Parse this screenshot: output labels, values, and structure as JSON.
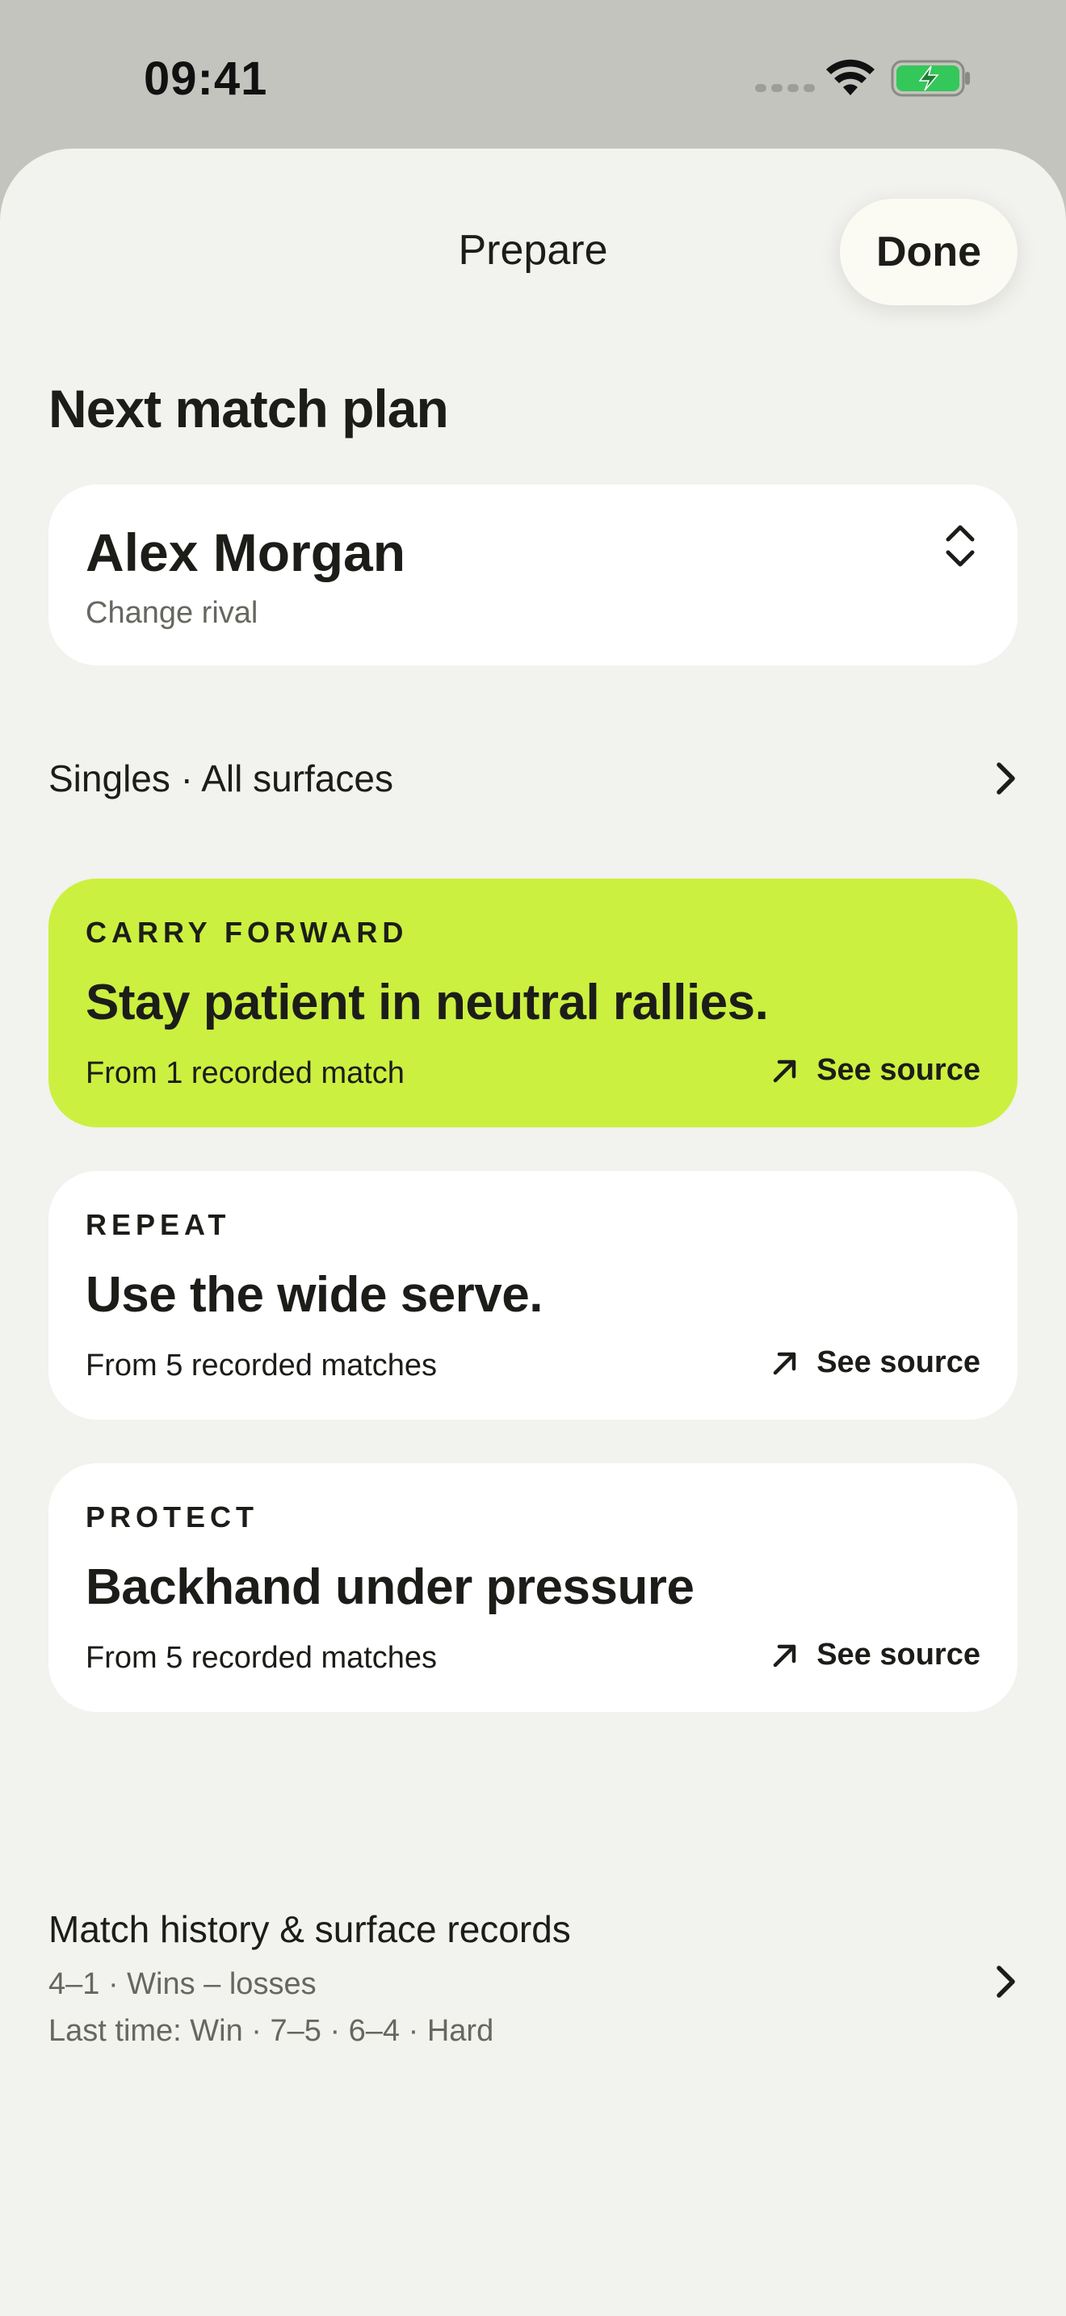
{
  "status_bar": {
    "time": "09:41",
    "icons": [
      "signal-dots-icon",
      "wifi-icon",
      "battery-charging-icon"
    ],
    "battery_color": "#34c759"
  },
  "sheet": {
    "title": "Prepare",
    "done_label": "Done"
  },
  "plan": {
    "heading": "Next match plan",
    "rival": {
      "name": "Alex Morgan",
      "subtitle": "Change rival",
      "icon": "chevron-up-down-icon"
    },
    "filter": {
      "label": "Singles · All surfaces",
      "icon": "chevron-right-icon"
    },
    "cards": [
      {
        "kicker": "CARRY FORWARD",
        "title": "Stay patient in neutral rallies.",
        "meta": "From 1 recorded match",
        "link": "See source",
        "icon": "arrow-up-right-icon",
        "accent": true
      },
      {
        "kicker": "REPEAT",
        "title": "Use the wide serve.",
        "meta": "From 5 recorded matches",
        "link": "See source",
        "icon": "arrow-up-right-icon",
        "accent": false
      },
      {
        "kicker": "PROTECT",
        "title": "Backhand under pressure",
        "meta": "From 5 recorded matches",
        "link": "See source",
        "icon": "arrow-up-right-icon",
        "accent": false
      }
    ],
    "history": {
      "title": "Match history & surface records",
      "record": "4–1 · Wins – losses",
      "last_time": "Last time: Win · 7–5 · 6–4 · Hard",
      "icon": "chevron-right-icon"
    }
  },
  "colors": {
    "accent": "#cbf040",
    "background": "#f2f2ee",
    "card": "#ffffff",
    "text": "#1c1d19",
    "muted": "#66675f"
  }
}
